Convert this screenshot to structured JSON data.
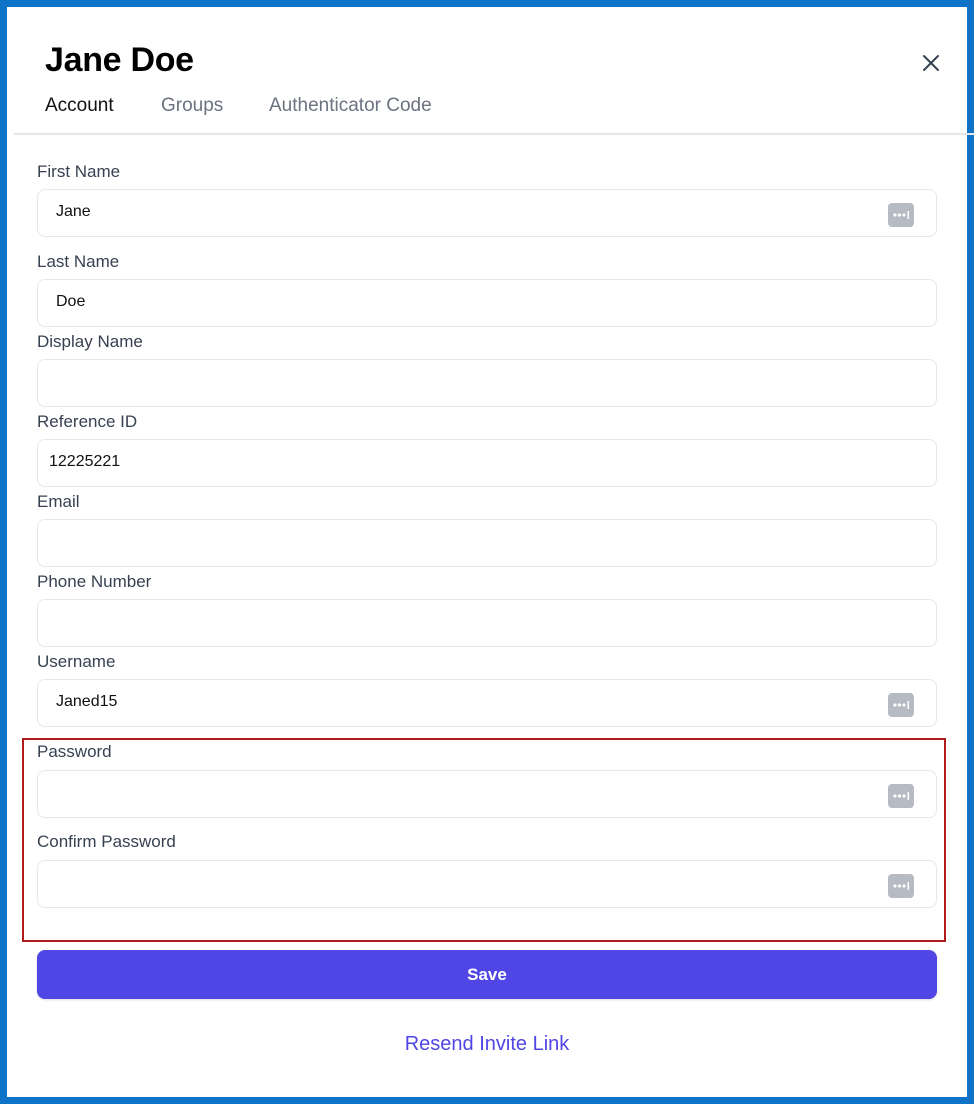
{
  "dialog": {
    "title": "Jane Doe",
    "tabs": [
      {
        "label": "Account",
        "active": true
      },
      {
        "label": "Groups",
        "active": false
      },
      {
        "label": "Authenticator Code",
        "active": false
      }
    ]
  },
  "form": {
    "first_name": {
      "label": "First Name",
      "value": "Jane"
    },
    "last_name": {
      "label": "Last Name",
      "value": "Doe"
    },
    "display_name": {
      "label": "Display Name",
      "value": ""
    },
    "reference_id": {
      "label": "Reference ID",
      "value": "12225221"
    },
    "email": {
      "label": "Email",
      "value": ""
    },
    "phone_number": {
      "label": "Phone Number",
      "value": ""
    },
    "username": {
      "label": "Username",
      "value": "Janed15"
    },
    "password": {
      "label": "Password",
      "value": ""
    },
    "confirm_password": {
      "label": "Confirm Password",
      "value": ""
    }
  },
  "actions": {
    "save_label": "Save",
    "resend_label": "Resend Invite Link"
  },
  "colors": {
    "frame_border": "#0f74c8",
    "primary": "#4f46e5",
    "highlight_box": "#b01c1c"
  },
  "icons": {
    "close": "close-icon",
    "autofill": "keychain-autofill-icon"
  }
}
